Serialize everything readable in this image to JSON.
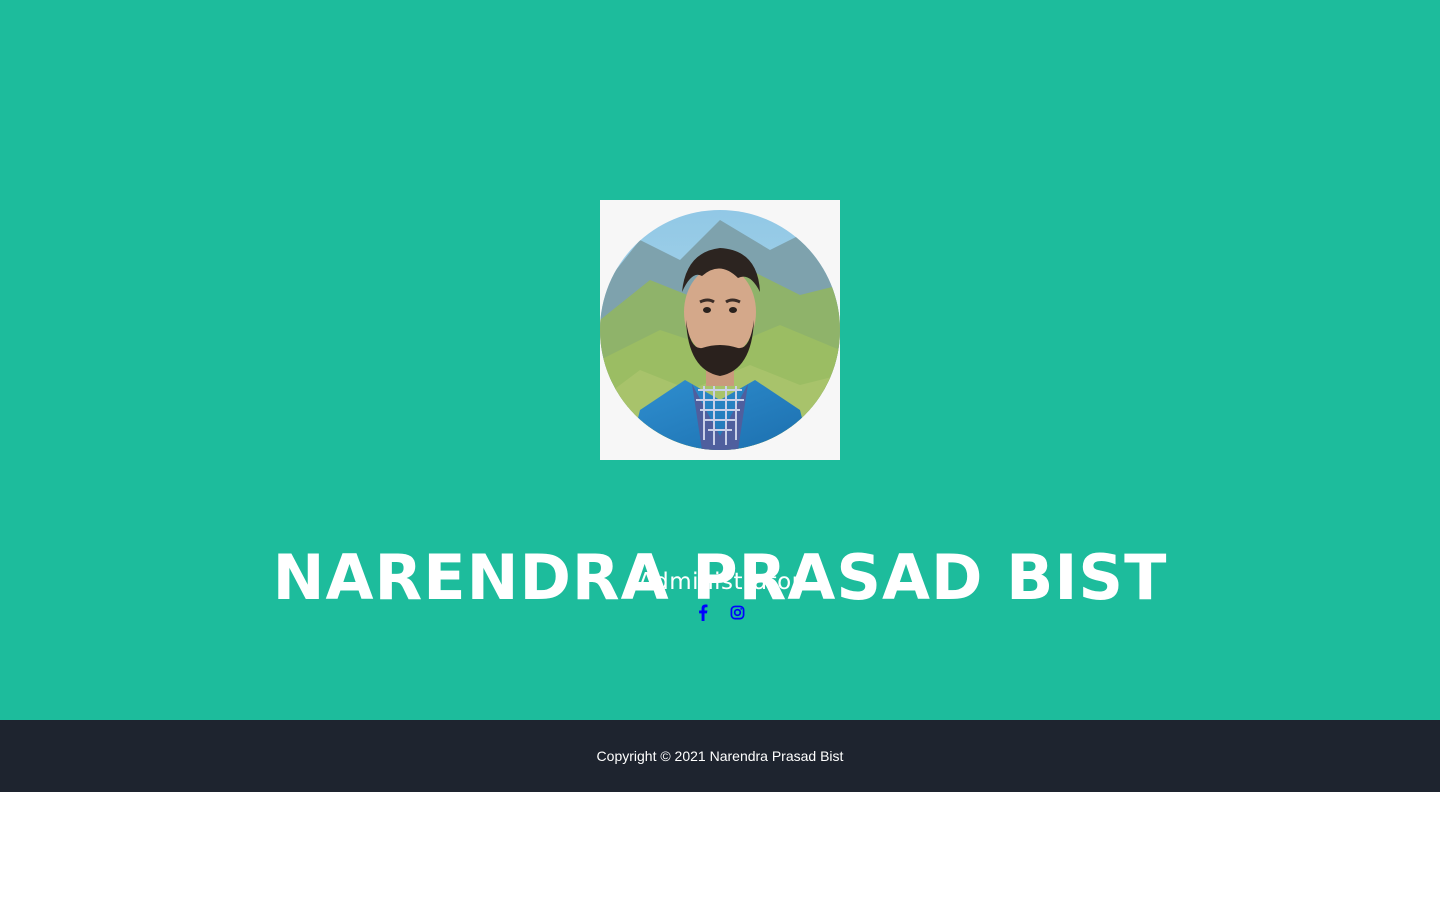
{
  "profile": {
    "name": "NARENDRA PRASAD BIST",
    "role": "Administrator",
    "avatar_alt": "profile photo"
  },
  "social": [
    {
      "icon": "facebook-icon",
      "color": "#0000ff"
    },
    {
      "icon": "instagram-icon",
      "color": "#0000ff"
    }
  ],
  "footer": {
    "copyright": "Copyright © 2021 Narendra Prasad Bist"
  },
  "colors": {
    "hero_background": "#1dbc9c",
    "footer_background": "#1e242f",
    "text": "#ffffff",
    "link": "#0000ff"
  }
}
